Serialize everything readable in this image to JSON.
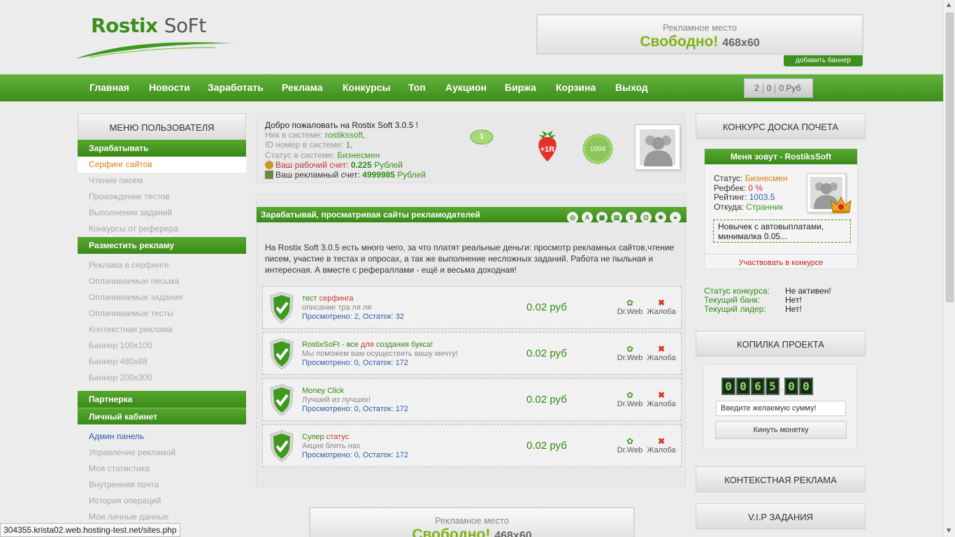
{
  "logo": {
    "part1": "Rostix",
    "part2": "SoFt"
  },
  "top_ad": {
    "line1": "Рекламное место",
    "free": "Свободно!",
    "size": "468x60",
    "add_banner": "добавить баннер"
  },
  "nav": [
    "Главная",
    "Новости",
    "Заработать",
    "Реклама",
    "Конкурсы",
    "Топ",
    "Аукцион",
    "Биржа",
    "Корзина",
    "Выход"
  ],
  "cart": {
    "items": "2",
    "count": "0",
    "amount": "0 Руб"
  },
  "left_menu": {
    "title": "МЕНЮ ПОЛЬЗОВАТЕЛЯ",
    "earn_title": "Зарабатывать",
    "earn_items": [
      "Серфинг сайтов",
      "Чтение писем",
      "Прохождение тестов",
      "Выполнение заданий",
      "Конкурсы от реферера"
    ],
    "ads_title": "Разместить рекламу",
    "ads_items": [
      "Реклама в серфинге",
      "Оплачиваемые письма",
      "Оплачиваемые задания",
      "Оплачиваемые тесты",
      "Контекстная реклама",
      "Баннер 100x100",
      "Баннер 480x68",
      "Баннер 200x300"
    ],
    "partner_title": "Партнерка",
    "cabinet_title": "Личный кабинет",
    "cabinet_items": [
      "Админ панель",
      "Управление рекламой",
      "Моя статистика",
      "Внутренняя почта",
      "История операций",
      "Мои личные данные"
    ]
  },
  "welcome": {
    "greeting": "Добро пожаловать на Rostix Soft 3.0.5 !",
    "nick_label": "Ник в системе:",
    "nick": "rostikssoft,",
    "id_label": "ID номер в системе:",
    "id": "1,",
    "status_label": "Статус в системе:",
    "status": "Бизнесмен",
    "work_label": "Ваш рабочий счет:",
    "work_value": "0.225",
    "work_unit": "Рублей",
    "ad_label": "Ваш рекламный счет:",
    "ad_value": "4999985",
    "ad_unit": "Рублей",
    "messages": "1",
    "plus_r": "+1R",
    "rating": "1004"
  },
  "surf": {
    "header": "Зарабатывай, просматривая сайты рекламодателей",
    "intro": "На Rostix Soft 3.0.5 есть много чего, за что платят реальные деньги: просмотр рекламных сайтов,чтение писем, участие в тестах и опросах, а так же выполнение несложных заданий. Работа не пыльная и интересная. А вместе с рефераллами - ещё и весьма доходная!",
    "drweb": "Dr.Web",
    "complaint": "Жалоба",
    "rows": [
      {
        "t1": "тест ",
        "t2": "серфинга",
        "t3": "",
        "desc": "описание тра ля ля",
        "stat": "Просмотрено: 2, Остаток: 32",
        "price": "0.02 руб"
      },
      {
        "t1": "RostixSoFt - все ",
        "t2": "для",
        "t3": " создания букса!",
        "desc": "Мы поможем вам осуществить вашу мечту!",
        "stat": "Просмотрено: 0, Остаток: 172",
        "price": "0.02 руб"
      },
      {
        "t1": "Money Click",
        "t2": "",
        "t3": "",
        "desc": "Лучший из лучших!",
        "stat": "Просмотрено: 0, Остаток: 172",
        "price": "0.02 руб"
      },
      {
        "t1": "Супер ",
        "t2": "статус",
        "t3": "",
        "desc": "Акция блять нах",
        "stat": "Просмотрено: 0, Остаток: 172",
        "price": "0.02 руб"
      }
    ]
  },
  "bottom_ad": {
    "line1": "Рекламное место",
    "free": "Свободно!",
    "size": "468x60"
  },
  "honor": {
    "title": "КОНКУРС ДОСКА ПОЧЕТА",
    "name": "Меня зовут - RostiksSoft",
    "status_label": "Статус:",
    "status": "Бизнесмен",
    "refback_label": "Рефбек:",
    "refback": "0 %",
    "rating_label": "Рейтинг:",
    "rating": "1003.5",
    "from_label": "Откуда:",
    "from": "Странник",
    "note": "Новычек с автовыплатами, минималка 0.05...",
    "participate": "Участвовать в конкурсе",
    "contest_status_label": "Статус конкурса:",
    "contest_status": "Не активен!",
    "bank_label": "Текущий банк:",
    "bank": "Нет!",
    "leader_label": "Текущий лидер:",
    "leader": "Нет!"
  },
  "piggy": {
    "title": "КОПИЛКА ПРОЕКТА",
    "digits": [
      "0",
      "0",
      "6",
      "5",
      "0",
      "0"
    ],
    "placeholder": "Введите желаемую сумму!",
    "button": "Кинуть монетку"
  },
  "ctx_ads": {
    "title": "КОНТЕКСТНАЯ РЕКЛАМА"
  },
  "vip": {
    "title": "V.I.P ЗАДАНИЯ"
  },
  "statusbar": {
    "url": "304355.krista02.web.hosting-test.net/sites.php"
  },
  "colors": {
    "green": "#3d8e1a",
    "accent_orange": "#d4820c",
    "price_green": "#2f8a14"
  }
}
